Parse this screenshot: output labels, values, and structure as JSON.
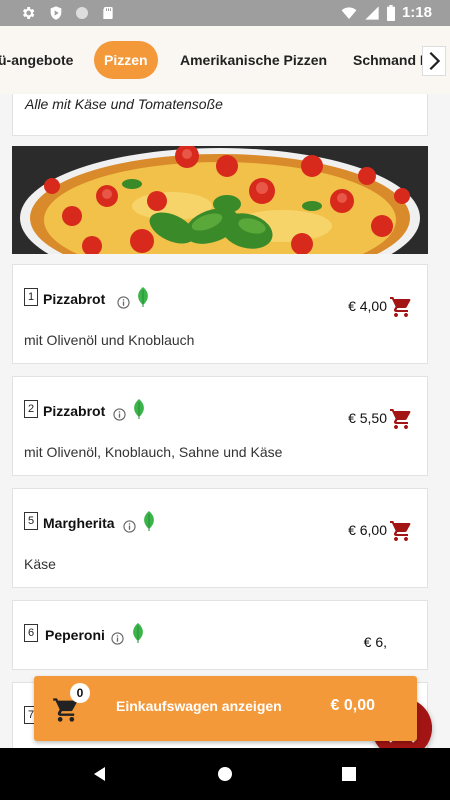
{
  "status_bar": {
    "time": "1:18"
  },
  "categories": [
    {
      "label": "ü-angebote",
      "active": false
    },
    {
      "label": "Pizzen",
      "active": true
    },
    {
      "label": "Amerikanische Pizzen",
      "active": false
    },
    {
      "label": "Schmand P",
      "active": false
    }
  ],
  "section_note": "Alle mit Käse und Tomatensoße",
  "items": [
    {
      "number": "1",
      "name": "Pizzabrot",
      "price": "€ 4,00",
      "description": "mit Olivenöl und Knoblauch"
    },
    {
      "number": "2",
      "name": "Pizzabrot",
      "price": "€ 5,50",
      "description": "mit Olivenöl, Knoblauch, Sahne und Käse"
    },
    {
      "number": "5",
      "name": "Margherita",
      "price": "€ 6,00",
      "description": "Käse"
    },
    {
      "number": "6",
      "name": "Peperoni",
      "price": "€ 6,",
      "description": ""
    },
    {
      "number": "7",
      "name": "",
      "price": "",
      "description": ""
    }
  ],
  "cart_bar": {
    "count": "0",
    "label": "Einkaufswagen anzeigen",
    "total": "€ 0,00"
  },
  "colors": {
    "accent": "#f4993a",
    "brand_red": "#a31414",
    "veg_green": "#3bb54a"
  },
  "icons": [
    "settings-icon",
    "shield-icon",
    "circle-icon",
    "sd-card-icon",
    "wifi-icon",
    "signal-icon",
    "battery-icon",
    "chevron-right-icon",
    "info-icon",
    "vegetarian-leaf-icon",
    "add-to-cart-icon",
    "double-chevron-up-icon",
    "shopping-cart-icon",
    "back-icon",
    "home-icon",
    "recents-icon"
  ]
}
